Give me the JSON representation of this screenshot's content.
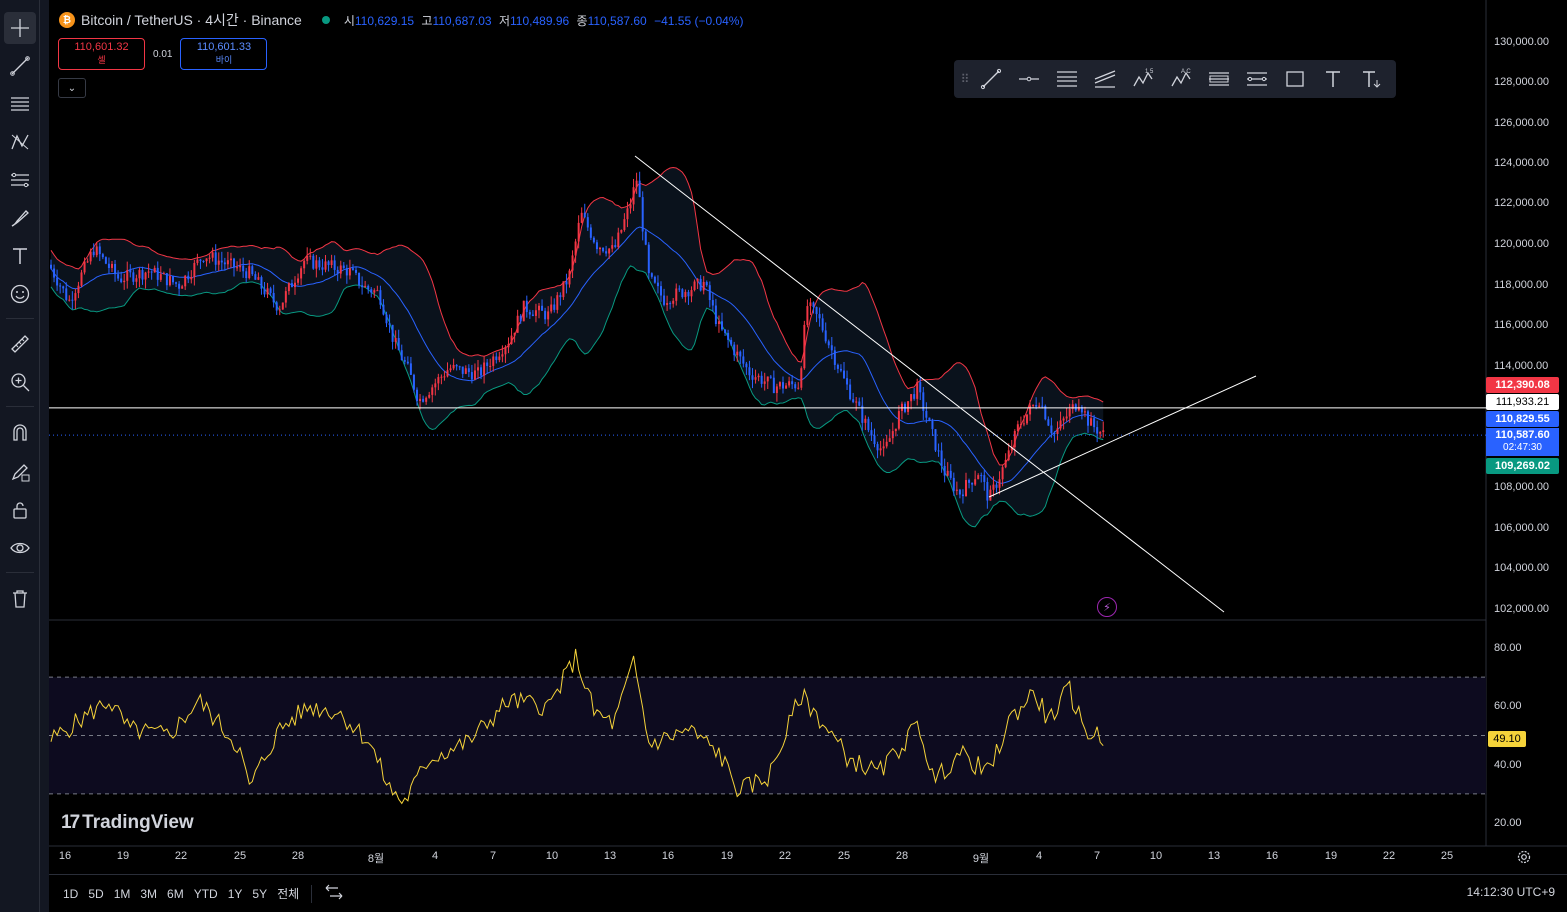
{
  "legend": {
    "symbol_icon": "bitcoin-icon",
    "title": "Bitcoin / TetherUS · 4시간 · Binance",
    "open_label": "시",
    "open": "110,629.15",
    "high_label": "고",
    "high": "110,687.03",
    "low_label": "저",
    "low": "110,489.96",
    "close_label": "종",
    "close": "110,587.60",
    "change": "−41.55 (−0.04%)"
  },
  "trade": {
    "sell_price": "110,601.32",
    "sell_label": "셀",
    "spread": "0.01",
    "buy_price": "110,601.33",
    "buy_label": "바이"
  },
  "price_axis": {
    "labels": [
      "130,000.00",
      "128,000.00",
      "126,000.00",
      "124,000.00",
      "122,000.00",
      "120,000.00",
      "118,000.00",
      "116,000.00",
      "114,000.00",
      "108,000.00",
      "106,000.00",
      "104,000.00",
      "102,000.00"
    ],
    "tags": {
      "bb_upper": "112,390.08",
      "hline": "111,933.21",
      "bb_basis": "110,829.55",
      "last_price": "110,587.60",
      "countdown": "02:47:30",
      "bb_lower": "109,269.02"
    }
  },
  "rsi_axis": {
    "labels": [
      "80.00",
      "60.00",
      "40.00",
      "20.00"
    ],
    "value": "49.10"
  },
  "time_axis": [
    "16",
    "19",
    "22",
    "25",
    "28",
    "8월",
    "4",
    "7",
    "10",
    "13",
    "16",
    "19",
    "22",
    "25",
    "28",
    "9월",
    "4",
    "7",
    "10",
    "13",
    "16",
    "19",
    "22",
    "25"
  ],
  "bottom_bar": {
    "ranges": [
      "1D",
      "5D",
      "1M",
      "3M",
      "6M",
      "YTD",
      "1Y",
      "5Y",
      "전체"
    ],
    "clock": "14:12:30 UTC+9"
  },
  "logo": "TradingView",
  "colors": {
    "up": "#f23645",
    "down": "#2962ff",
    "bb_upper": "#f23645",
    "bb_basis": "#2962ff",
    "bb_lower": "#089981",
    "rsi": "#f5d33a",
    "hline": "#ffffff"
  },
  "left_tools": [
    "crosshair-icon",
    "trendline-icon",
    "fib-icon",
    "pattern-icon",
    "forecast-icon",
    "brush-icon",
    "text-icon",
    "emoji-icon",
    "ruler-icon",
    "zoom-in-icon",
    "magnet-icon",
    "lock-drawing-icon",
    "lock-icon",
    "eye-icon",
    "trash-icon"
  ],
  "draw_tools": [
    "trendline-icon",
    "hline-icon",
    "parallel-channel-icon",
    "regression-icon",
    "elliott-icon",
    "abcd-icon",
    "fib-retracement-icon",
    "fib-extension-icon",
    "rectangle-icon",
    "text-icon",
    "text-anchor-icon"
  ]
}
